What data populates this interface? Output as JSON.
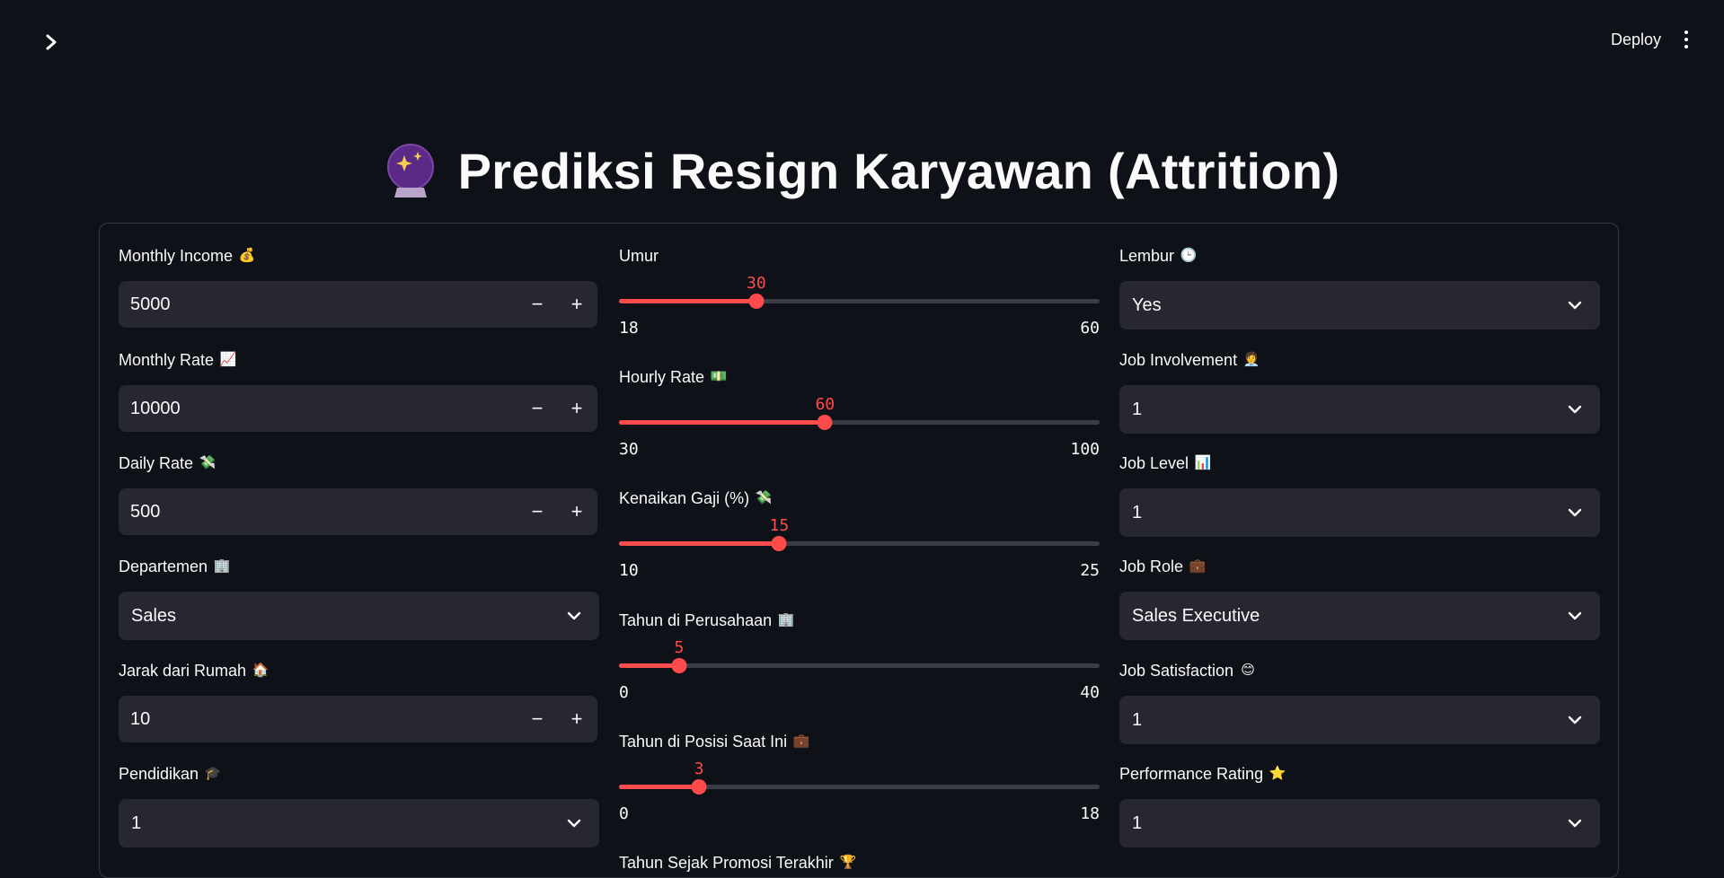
{
  "header": {
    "deploy_label": "Deploy",
    "sidebar_toggle_icon": "chevron-right-icon",
    "menu_icon": "vertical-dots-icon"
  },
  "title": {
    "text": "Prediksi Resign Karyawan (Attrition)",
    "icon": "crystal-ball-icon"
  },
  "left_column": {
    "monthly_income": {
      "label": "Monthly Income",
      "emoji": "💰",
      "value": "5000"
    },
    "monthly_rate": {
      "label": "Monthly Rate",
      "emoji": "📈",
      "value": "10000"
    },
    "daily_rate": {
      "label": "Daily Rate",
      "emoji": "💸",
      "value": "500"
    },
    "departemen": {
      "label": "Departemen",
      "emoji": "🏢",
      "value": "Sales"
    },
    "jarak": {
      "label": "Jarak dari Rumah",
      "emoji": "🏠",
      "value": "10"
    },
    "pendidikan": {
      "label": "Pendidikan",
      "emoji": "🎓",
      "value": "1"
    }
  },
  "middle_column": {
    "umur": {
      "label": "Umur",
      "emoji": "",
      "value": "30",
      "min": "18",
      "max": "60"
    },
    "hourly_rate": {
      "label": "Hourly Rate",
      "emoji": "💵",
      "value": "60",
      "min": "30",
      "max": "100"
    },
    "kenaikan_gaji": {
      "label": "Kenaikan Gaji (%)",
      "emoji": "💸",
      "value": "15",
      "min": "10",
      "max": "25"
    },
    "tahun_perusahaan": {
      "label": "Tahun di Perusahaan",
      "emoji": "🏢",
      "value": "5",
      "min": "0",
      "max": "40"
    },
    "tahun_posisi": {
      "label": "Tahun di Posisi Saat Ini",
      "emoji": "💼",
      "value": "3",
      "min": "0",
      "max": "18"
    },
    "tahun_promosi": {
      "label": "Tahun Sejak Promosi Terakhir",
      "emoji": "🏆"
    }
  },
  "right_column": {
    "lembur": {
      "label": "Lembur",
      "emoji": "🕒",
      "value": "Yes"
    },
    "job_involvement": {
      "label": "Job Involvement",
      "emoji": "🧑‍💼",
      "value": "1"
    },
    "job_level": {
      "label": "Job Level",
      "emoji": "📊",
      "value": "1"
    },
    "job_role": {
      "label": "Job Role",
      "emoji": "💼",
      "value": "Sales Executive"
    },
    "job_satisfaction": {
      "label": "Job Satisfaction",
      "emoji": "😊",
      "value": "1"
    },
    "performance_rating": {
      "label": "Performance Rating",
      "emoji": "⭐",
      "value": "1"
    }
  },
  "colors": {
    "background": "#0e1117",
    "input_bg": "#262730",
    "accent": "#ff4b4b",
    "text": "#fafafa"
  }
}
